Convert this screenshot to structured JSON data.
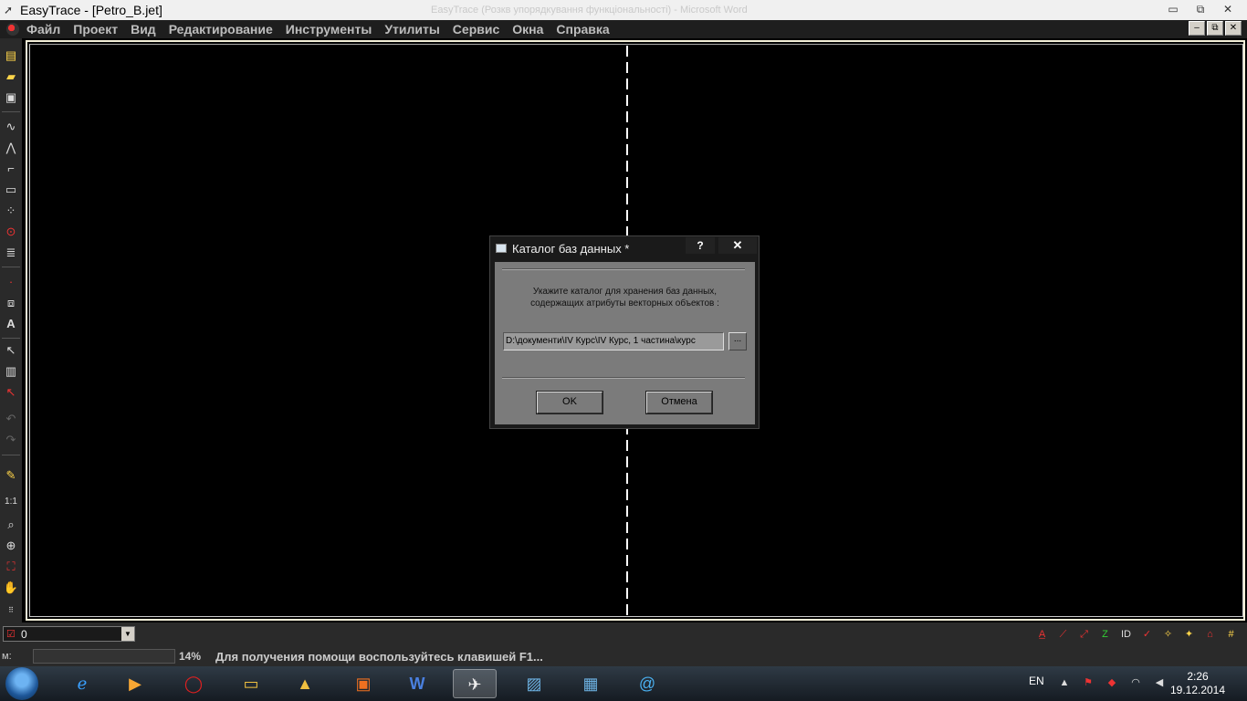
{
  "window": {
    "title": "EasyTrace - [Petro_B.jet]",
    "background_title": "EasyTrace (Розкв упорядкування функціональності) - Microsoft Word",
    "controls": {
      "minimize": "▭",
      "restore": "⧉",
      "close": "✕"
    }
  },
  "menu": {
    "items": [
      "Файл",
      "Проект",
      "Вид",
      "Редактирование",
      "Инструменты",
      "Утилиты",
      "Сервис",
      "Окна",
      "Справка"
    ]
  },
  "mdi_controls": {
    "minimize": "–",
    "restore": "⧉",
    "close": "✕"
  },
  "dialog": {
    "title": "Каталог баз данных *",
    "help_label": "?",
    "close_label": "✕",
    "prompt_line1": "Укажите каталог для хранения баз данных,",
    "prompt_line2": "содержащих атрибуты векторных объектов :",
    "path_value": "D:\\документи\\IV Курс\\IV Курс, 1 частина\\курс",
    "browse_label": "...",
    "ok_label": "OK",
    "cancel_label": "Отмена"
  },
  "layer": {
    "value": "0",
    "dropdown_arrow": "▼"
  },
  "status": {
    "m_label": "м:",
    "zoom": "14%",
    "help_text": "Для получения помощи воспользуйтесь клавишей F1..."
  },
  "taskbar": {
    "lang": "EN",
    "time": "2:26",
    "date": "19.12.2014"
  },
  "colors": {
    "canvas": "#000000",
    "dialog_body": "#7b7b7b",
    "accent_red": "#ee3333"
  }
}
